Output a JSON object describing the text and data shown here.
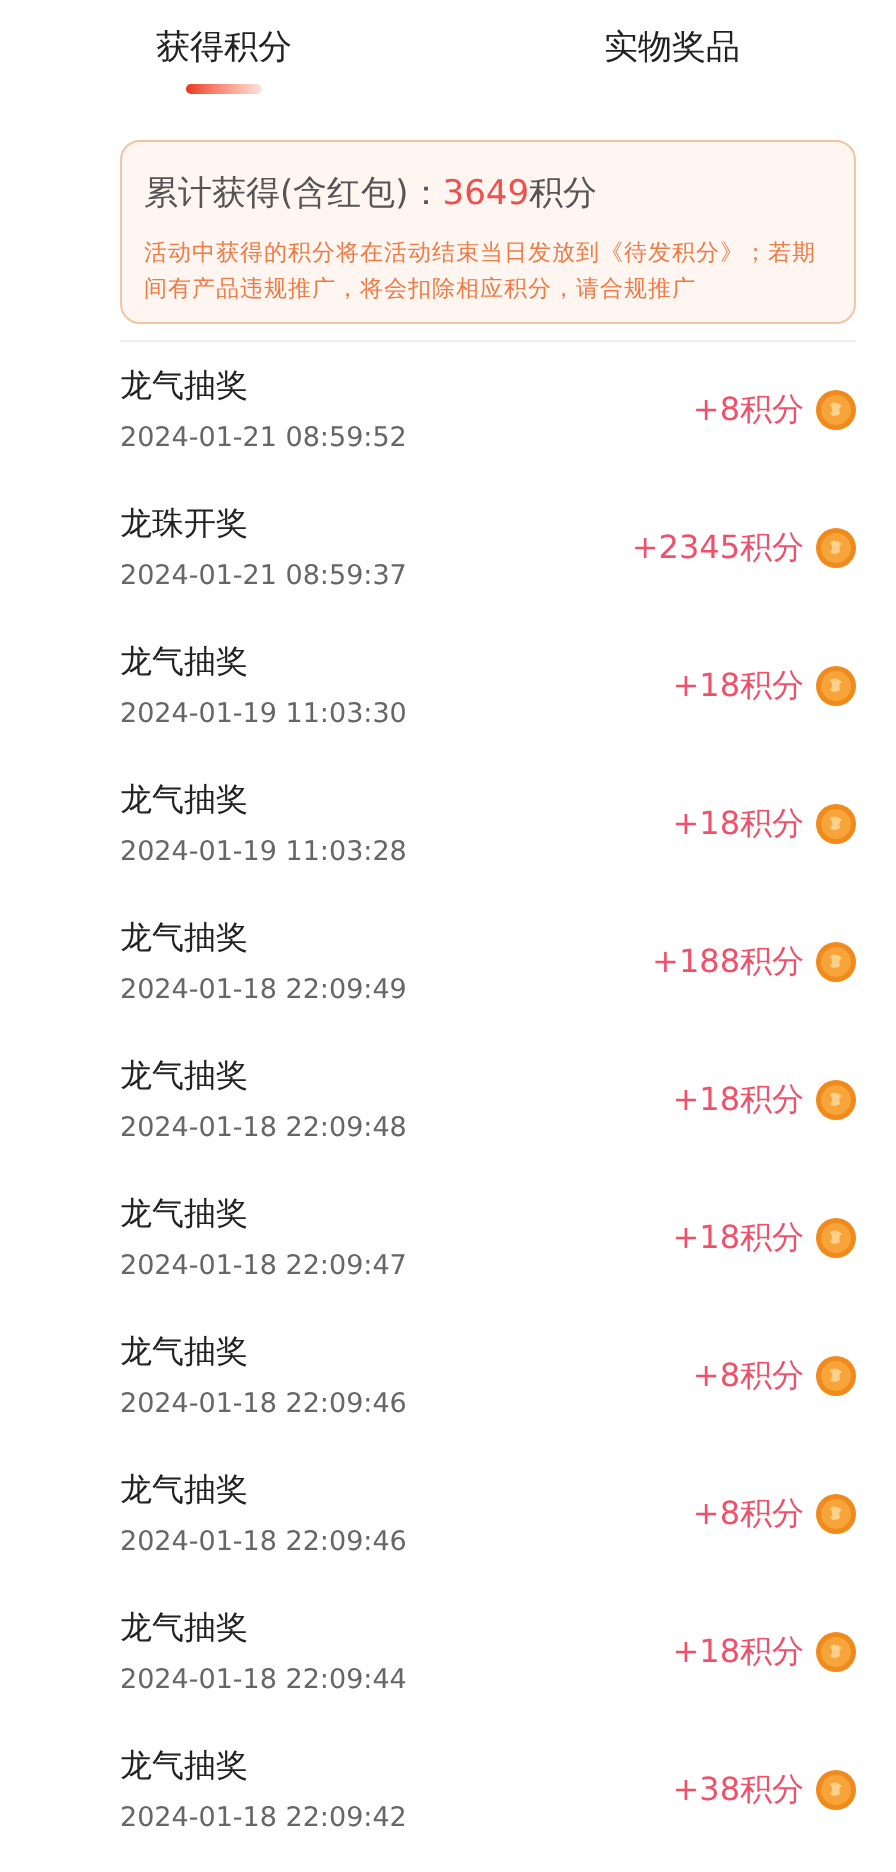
{
  "tabs": [
    {
      "label": "获得积分",
      "selected": true
    },
    {
      "label": "实物奖品",
      "selected": false
    }
  ],
  "summary": {
    "label": "累计获得(含红包)：",
    "value": "3649",
    "unit": "积分",
    "notice": "活动中获得的积分将在活动结束当日发放到《待发积分》；若期间有产品违规推广，将会扣除相应积分，请合规推广"
  },
  "records": [
    {
      "title": "龙气抽奖",
      "time": "2024-01-21 08:59:52",
      "amount": "+8积分"
    },
    {
      "title": "龙珠开奖",
      "time": "2024-01-21 08:59:37",
      "amount": "+2345积分"
    },
    {
      "title": "龙气抽奖",
      "time": "2024-01-19 11:03:30",
      "amount": "+18积分"
    },
    {
      "title": "龙气抽奖",
      "time": "2024-01-19 11:03:28",
      "amount": "+18积分"
    },
    {
      "title": "龙气抽奖",
      "time": "2024-01-18 22:09:49",
      "amount": "+188积分"
    },
    {
      "title": "龙气抽奖",
      "time": "2024-01-18 22:09:48",
      "amount": "+18积分"
    },
    {
      "title": "龙气抽奖",
      "time": "2024-01-18 22:09:47",
      "amount": "+18积分"
    },
    {
      "title": "龙气抽奖",
      "time": "2024-01-18 22:09:46",
      "amount": "+8积分"
    },
    {
      "title": "龙气抽奖",
      "time": "2024-01-18 22:09:46",
      "amount": "+8积分"
    },
    {
      "title": "龙气抽奖",
      "time": "2024-01-18 22:09:44",
      "amount": "+18积分"
    },
    {
      "title": "龙气抽奖",
      "time": "2024-01-18 22:09:42",
      "amount": "+38积分"
    }
  ]
}
